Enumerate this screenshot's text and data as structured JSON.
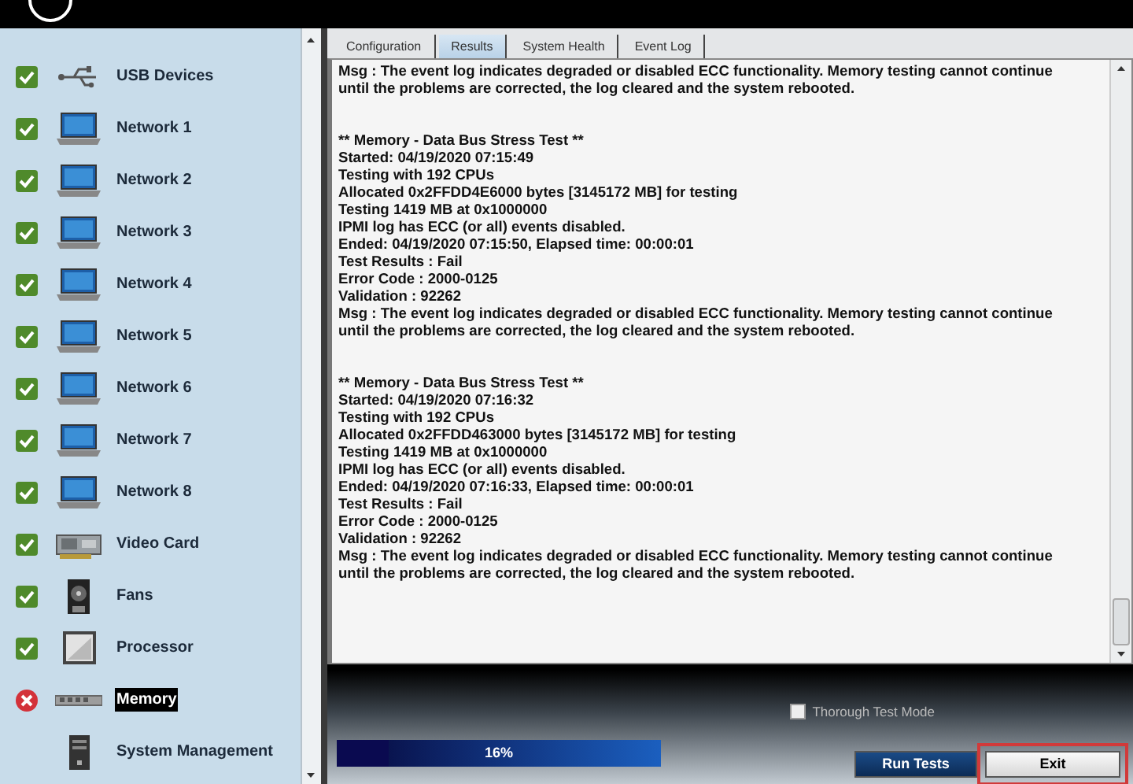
{
  "sidebar": {
    "items": [
      {
        "label": "USB Devices",
        "kind": "usb",
        "passed": true,
        "failed": false,
        "selected": false
      },
      {
        "label": "Network 1",
        "kind": "network",
        "passed": true,
        "failed": false,
        "selected": false
      },
      {
        "label": "Network 2",
        "kind": "network",
        "passed": true,
        "failed": false,
        "selected": false
      },
      {
        "label": "Network 3",
        "kind": "network",
        "passed": true,
        "failed": false,
        "selected": false
      },
      {
        "label": "Network 4",
        "kind": "network",
        "passed": true,
        "failed": false,
        "selected": false
      },
      {
        "label": "Network 5",
        "kind": "network",
        "passed": true,
        "failed": false,
        "selected": false
      },
      {
        "label": "Network 6",
        "kind": "network",
        "passed": true,
        "failed": false,
        "selected": false
      },
      {
        "label": "Network 7",
        "kind": "network",
        "passed": true,
        "failed": false,
        "selected": false
      },
      {
        "label": "Network 8",
        "kind": "network",
        "passed": true,
        "failed": false,
        "selected": false
      },
      {
        "label": "Video Card",
        "kind": "video",
        "passed": true,
        "failed": false,
        "selected": false
      },
      {
        "label": "Fans",
        "kind": "fan",
        "passed": true,
        "failed": false,
        "selected": false
      },
      {
        "label": "Processor",
        "kind": "processor",
        "passed": true,
        "failed": false,
        "selected": false
      },
      {
        "label": "Memory",
        "kind": "memory",
        "passed": false,
        "failed": true,
        "selected": true
      },
      {
        "label": "System Management",
        "kind": "system",
        "passed": false,
        "failed": false,
        "selected": false
      }
    ]
  },
  "tabs": [
    {
      "label": "Configuration",
      "selected": false
    },
    {
      "label": "Results",
      "selected": true
    },
    {
      "label": "System Health",
      "selected": false
    },
    {
      "label": "Event Log",
      "selected": false
    }
  ],
  "log": {
    "blocks": [
      {
        "lines": [
          "Msg : The event log indicates degraded or disabled ECC functionality.  Memory testing cannot continue",
          "until the problems are corrected, the log cleared and the system rebooted."
        ]
      },
      {
        "lines": [
          "** Memory - Data Bus Stress Test **",
          "Started: 04/19/2020 07:15:49",
          "Testing with 192 CPUs",
          "Allocated 0x2FFDD4E6000 bytes [3145172 MB] for testing",
          "Testing 1419 MB at 0x1000000",
          "IPMI log has ECC (or all) events disabled.",
          "Ended: 04/19/2020 07:15:50, Elapsed time: 00:00:01",
          "Test Results : Fail",
          "Error Code : 2000-0125",
          "Validation : 92262",
          "Msg : The event log indicates degraded or disabled ECC functionality.  Memory testing cannot continue",
          "until the problems are corrected, the log cleared and the system rebooted."
        ]
      },
      {
        "lines": [
          "** Memory - Data Bus Stress Test **",
          "Started: 04/19/2020 07:16:32",
          "Testing with 192 CPUs",
          "Allocated 0x2FFDD463000 bytes [3145172 MB] for testing",
          "Testing 1419 MB at 0x1000000",
          "IPMI log has ECC (or all) events disabled.",
          "Ended: 04/19/2020 07:16:33, Elapsed time: 00:00:01",
          "Test Results : Fail",
          "Error Code : 2000-0125",
          "Validation : 92262",
          "Msg : The event log indicates degraded or disabled ECC functionality.  Memory testing cannot continue",
          "until the problems are corrected, the log cleared and the system rebooted."
        ]
      }
    ]
  },
  "thorough_test_mode": {
    "label": "Thorough Test Mode",
    "checked": false
  },
  "progress": {
    "level": 0.16,
    "reading": "16%"
  },
  "buttons": [
    {
      "label": "Run Tests",
      "kind": "primary",
      "highlighted": false
    },
    {
      "label": "Exit",
      "kind": "default",
      "highlighted": true
    }
  ]
}
